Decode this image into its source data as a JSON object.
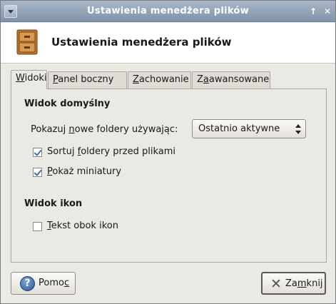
{
  "window": {
    "title": "Ustawienia menedżera plików",
    "up_glyph": "↑",
    "close_glyph": "✕"
  },
  "header": {
    "icon": "file-cabinet-icon",
    "title": "Ustawienia menedżera plików"
  },
  "tabs": [
    {
      "label_pre": "",
      "label_u": "W",
      "label_post": "idoki",
      "active": true
    },
    {
      "label_pre": "",
      "label_u": "P",
      "label_post": "anel boczny",
      "active": false
    },
    {
      "label_pre": "",
      "label_u": "Z",
      "label_post": "achowanie",
      "active": false
    },
    {
      "label_pre": "Z",
      "label_u": "a",
      "label_post": "awansowane",
      "active": false
    }
  ],
  "default_view": {
    "title": "Widok domyślny",
    "label_pre": "Pokazuj ",
    "label_u": "n",
    "label_post": "owe foldery używając:",
    "combo_value": "Ostatnio aktywne",
    "sort_pre": "Sortuj ",
    "sort_u": "f",
    "sort_post": "oldery przed plikami",
    "sort_checked": true,
    "thumb_pre": "",
    "thumb_u": "P",
    "thumb_post": "okaż miniatury",
    "thumb_checked": true
  },
  "icon_view": {
    "title": "Widok ikon",
    "text_pre": "",
    "text_u": "T",
    "text_post": "ekst obok ikon",
    "text_checked": false
  },
  "buttons": {
    "help_pre": "Pomo",
    "help_u": "c",
    "help_post": "",
    "close_pre": "Za",
    "close_u": "m",
    "close_post": "knij"
  },
  "colors": {
    "titlebar": "#8193aa",
    "check_accent": "#3f6fb3"
  }
}
